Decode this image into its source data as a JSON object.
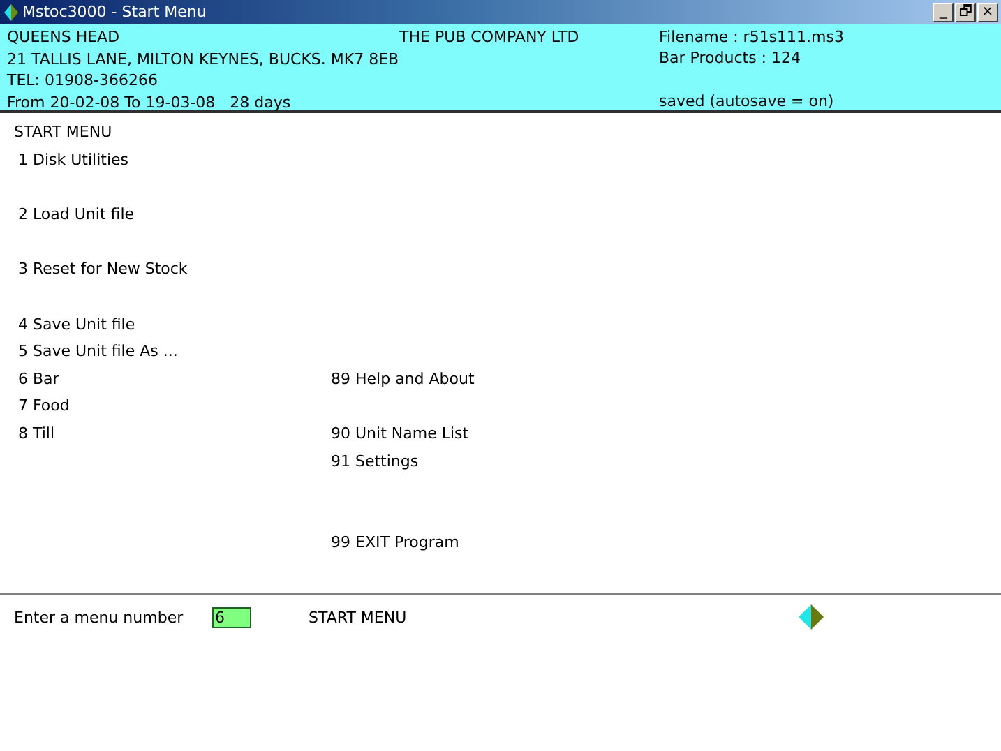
{
  "window": {
    "title": "Mstoc3000 - Start Menu",
    "controls": [
      "_",
      "🗗",
      "×"
    ]
  },
  "header": {
    "site": [
      "QUEENS HEAD",
      "21 TALLIS LANE, MILTON KEYNES, BUCKS. MK7 8EB",
      "TEL: 01908-366266",
      "From 20-02-08 To 19-03-08   28 days"
    ],
    "company": "THE PUB COMPANY LTD",
    "file": [
      "Filename : r51s111.ms3",
      "Bar Products : 124",
      "saved (autosave = on)"
    ]
  },
  "menu": {
    "title": "START MENU",
    "left": [
      "1 Disk Utilities",
      "2 Load Unit file",
      "3 Reset for New Stock",
      "4 Save Unit file",
      "5 Save Unit file As ...",
      "6 Bar",
      "7 Food",
      "8 Till"
    ],
    "right": [
      "89 Help and About",
      "90 Unit Name List",
      "91 Settings",
      "99 EXIT Program"
    ]
  },
  "prompt": {
    "label": "Enter a menu number",
    "value": "6",
    "current": "START MENU"
  }
}
